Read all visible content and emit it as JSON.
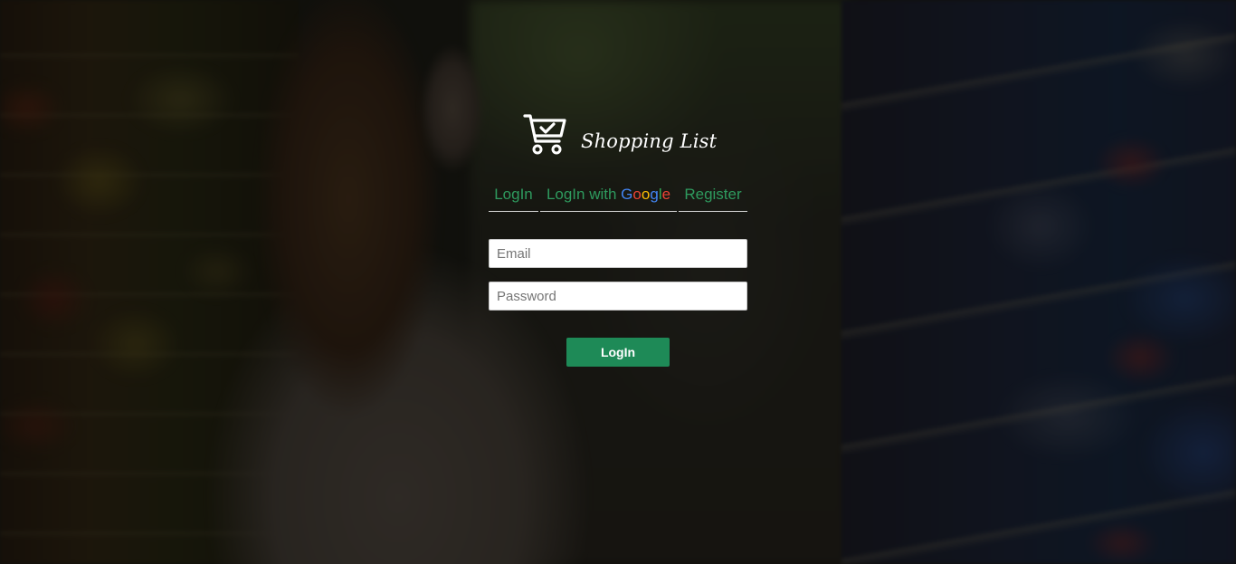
{
  "brand": {
    "name": "Shopping List",
    "icon": "cart-check-icon"
  },
  "tabs": {
    "login": "LogIn",
    "google_prefix": "LogIn with ",
    "google_letters": [
      "G",
      "o",
      "o",
      "g",
      "l",
      "e"
    ],
    "register": "Register"
  },
  "form": {
    "email_placeholder": "Email",
    "email_value": "",
    "password_placeholder": "Password",
    "password_value": "",
    "submit_label": "LogIn"
  },
  "colors": {
    "accent": "#2e9a5e",
    "button": "#1e8a57",
    "google_blue": "#4285f4",
    "google_red": "#ea4335",
    "google_yellow": "#fbbc05",
    "google_green": "#34a853"
  }
}
